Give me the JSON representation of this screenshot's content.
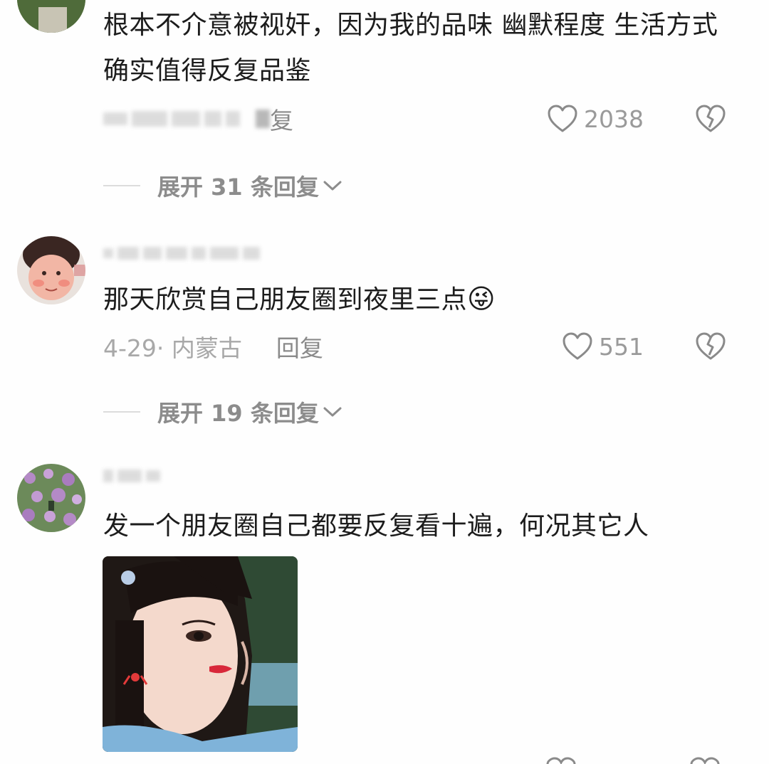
{
  "comments": [
    {
      "text": "根本不介意被视奸，因为我的品味 幽默程度 生活方式 确实值得反复品鉴",
      "reply_label": "复",
      "likes": "2038",
      "expand_label": "展开 31 条回复"
    },
    {
      "text": "那天欣赏自己朋友圈到夜里三点",
      "emoji": "😜",
      "date_location": "4-29· 内蒙古",
      "reply_label": "回复",
      "likes": "551",
      "expand_label": "展开 19 条回复"
    },
    {
      "text": "发一个朋友圈自己都要反复看十遍，何况其它人"
    }
  ],
  "icons": {
    "like": "heart-outline-icon",
    "dislike": "broken-heart-icon",
    "expand": "chevron-down-icon"
  },
  "colors": {
    "text": "#1c1c1c",
    "meta": "#a8a8a8",
    "icon": "#8a8a8a",
    "divider": "#dcdcdc"
  }
}
